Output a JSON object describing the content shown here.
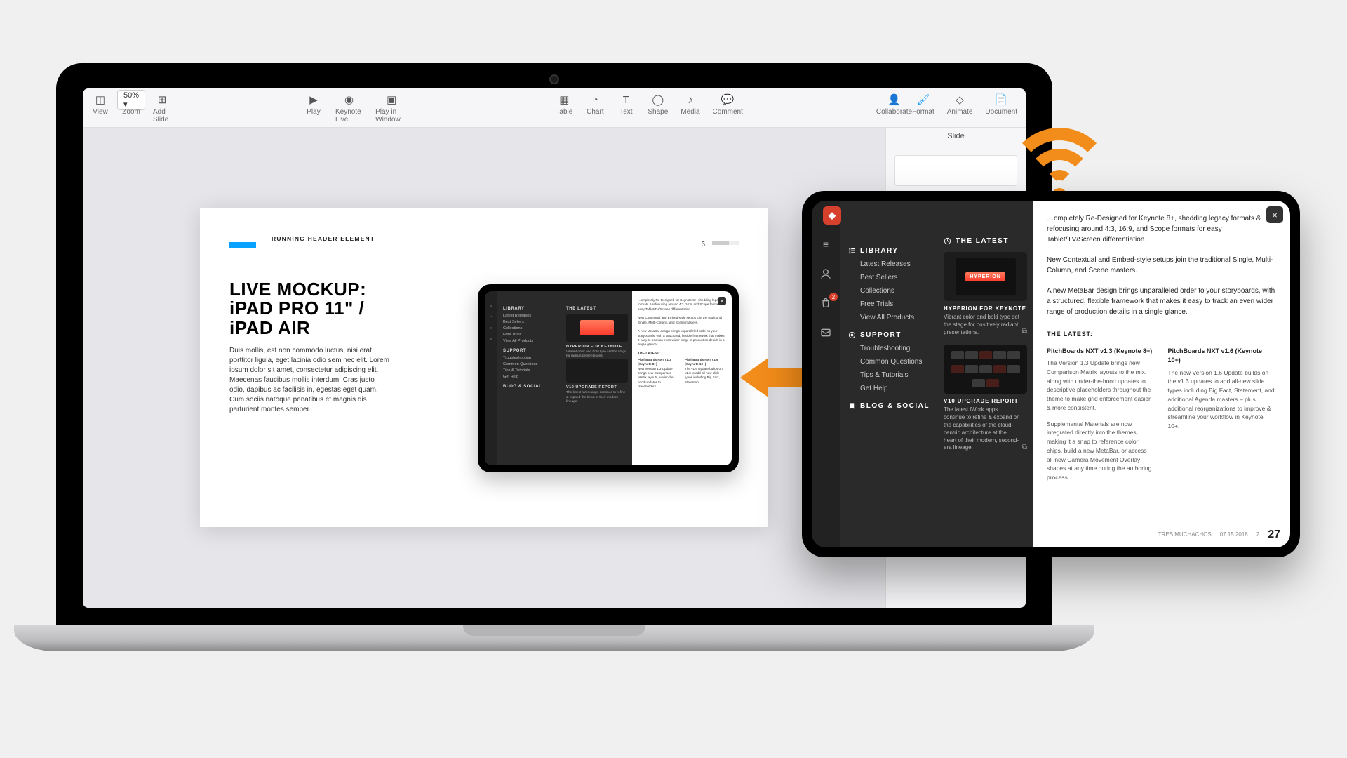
{
  "keynote": {
    "toolbar": {
      "left": {
        "view": "View",
        "zoom": "50% ▾",
        "zoom_label": "Zoom",
        "add_slide": "Add Slide"
      },
      "play": {
        "play": "Play",
        "keynote_live": "Keynote Live",
        "play_window": "Play in Window"
      },
      "insert": {
        "table": "Table",
        "chart": "Chart",
        "text": "Text",
        "shape": "Shape",
        "media": "Media",
        "comment": "Comment"
      },
      "collab": {
        "collaborate": "Collaborate"
      },
      "right": {
        "format": "Format",
        "animate": "Animate",
        "document": "Document"
      }
    },
    "inspector": {
      "tab": "Slide"
    }
  },
  "slide": {
    "running_header": "RUNNING HEADER ELEMENT",
    "page": "6",
    "title": "LIVE MOCKUP: iPAD PRO 11\" / iPAD AIR",
    "body": "Duis mollis, est non commodo luctus, nisi erat porttitor ligula, eget lacinia odio sem nec elit. Lorem ipsum dolor sit amet, consectetur adipiscing elit. Maecenas faucibus mollis interdum. Cras justo odio, dapibus ac facilisis in, egestas eget quam. Cum sociis natoque penatibus et magnis dis parturient montes semper."
  },
  "mini": {
    "sections": {
      "library": "LIBRARY",
      "support": "SUPPORT",
      "blog": "BLOG & SOCIAL",
      "latest": "THE LATEST"
    },
    "links": [
      "Latest Releases",
      "Best Sellers",
      "Collections",
      "Free Trials",
      "View All Products",
      "Troubleshooting",
      "Common Questions",
      "Tips & Tutorials",
      "Get Help"
    ],
    "card1_title": "HYPERION FOR KEYNOTE",
    "card2_title": "V10 UPGRADE REPORT"
  },
  "ipad": {
    "badge": "2",
    "nav": {
      "library": "LIBRARY",
      "library_items": [
        "Latest Releases",
        "Best Sellers",
        "Collections",
        "Free Trials",
        "View All Products"
      ],
      "support": "SUPPORT",
      "support_items": [
        "Troubleshooting",
        "Common Questions",
        "Tips & Tutorials",
        "Get Help"
      ],
      "blog": "BLOG & SOCIAL"
    },
    "latest": {
      "heading": "THE LATEST",
      "card1_title": "HYPERION FOR KEYNOTE",
      "card1_sub": "Vibrant color and bold type set the stage for positively radiant presentations.",
      "card2_title": "V10 UPGRADE REPORT",
      "card2_sub": "The latest iWork apps continue to refine & expand on the capabilities of the cloud-centric architecture at the heart of their modern, second-era lineage."
    },
    "doc": {
      "p1": "…ompletely Re-Designed for Keynote 8+, shedding legacy formats & refocusing around 4:3, 16:9, and Scope formats for easy Tablet/TV/Screen differentiation.",
      "p2": "New Contextual and Embed-style setups join the traditional Single, Multi-Column, and Scene masters.",
      "p3": "A new MetaBar design brings unparalleled order to your storyboards, with a structured, flexible framework that makes it easy to track an even wider range of production details in a single glance.",
      "latest_h": "THE LATEST:",
      "col1_h": "PitchBoards NXT v1.3 (Keynote 8+)",
      "col1_p1": "The Version 1.3 Update brings new Comparison Matrix layouts to the mix, along with under-the-hood updates to descriptive placeholders throughout the theme to make grid enforcement easier & more consistent.",
      "col1_p2": "Supplemental Materials are now integrated directly into the themes, making it a snap to reference color chips, build a new MetaBar, or access all-new Camera Movement Overlay shapes at any time during the authoring process.",
      "col2_h": "PitchBoards NXT v1.6 (Keynote 10+)",
      "col2_p": "The new Version 1.6 Update builds on the v1.3 updates to add all-new slide types including Big Fact, Statement, and additional Agenda masters – plus additional reorganizations to improve & streamline your workflow in Keynote 10+.",
      "footer_name": "TRES MUCHACHOS",
      "footer_date": "07.15.2018",
      "footer_small": "2",
      "footer_big": "27"
    }
  }
}
